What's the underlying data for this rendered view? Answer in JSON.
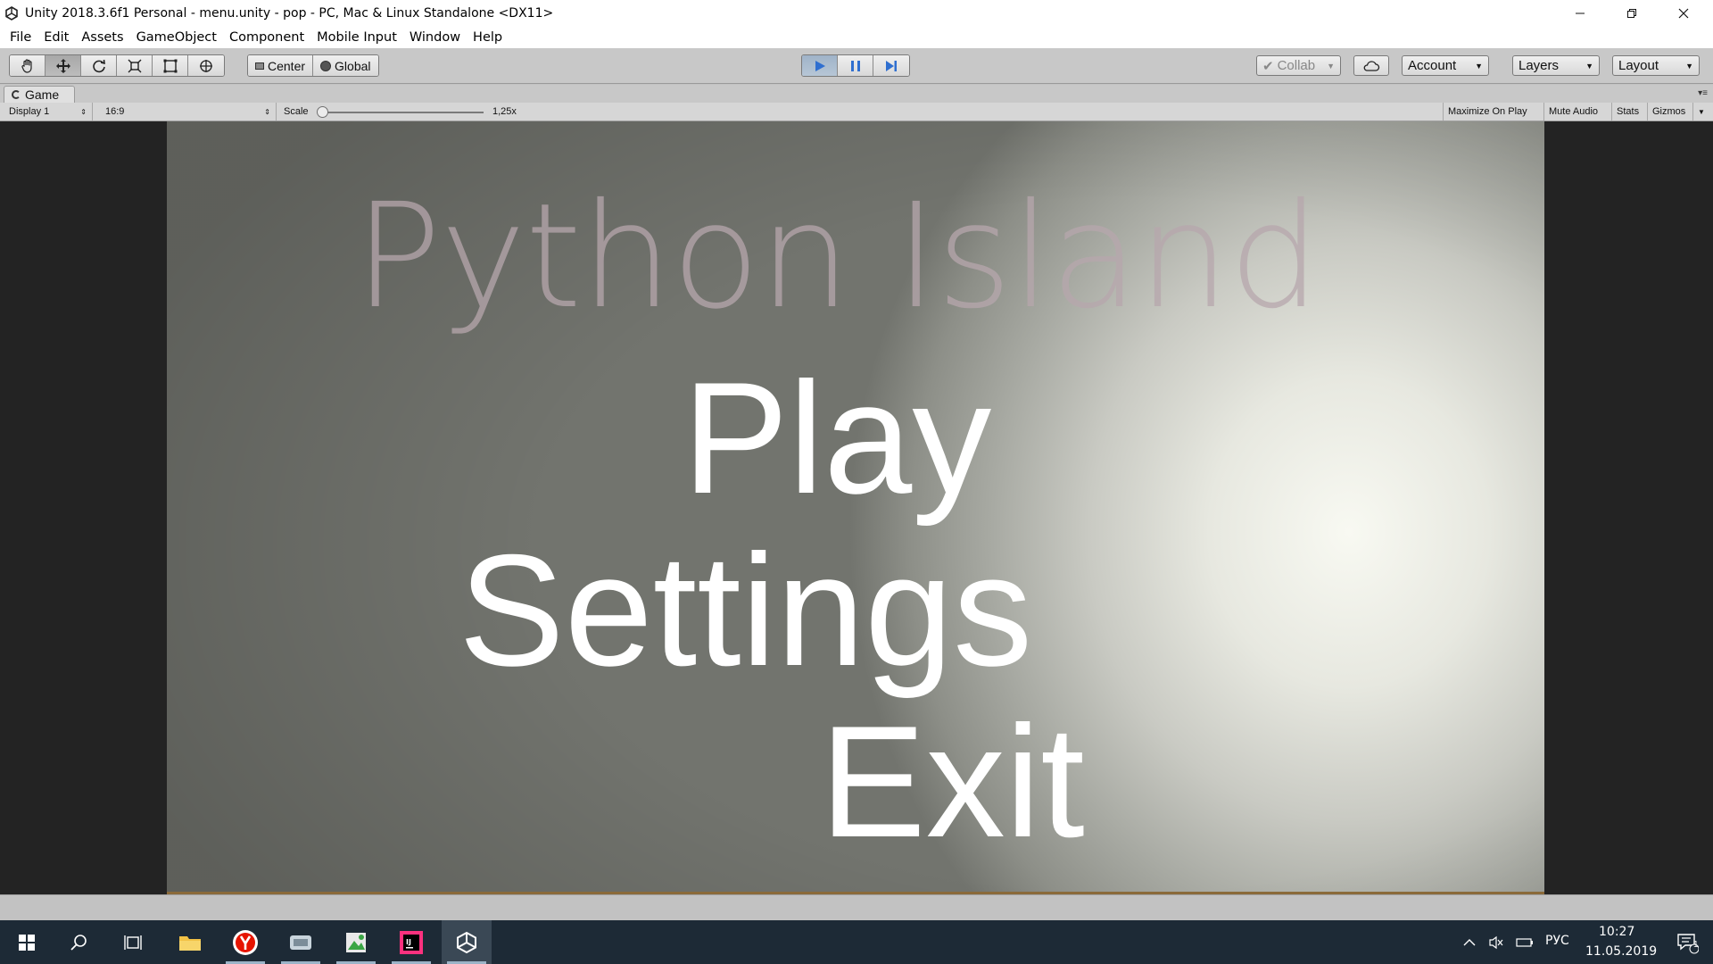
{
  "window": {
    "title": "Unity 2018.3.6f1 Personal - menu.unity - pop - PC, Mac & Linux Standalone <DX11>"
  },
  "menubar": {
    "items": [
      "File",
      "Edit",
      "Assets",
      "GameObject",
      "Component",
      "Mobile Input",
      "Window",
      "Help"
    ]
  },
  "toolbar": {
    "tools": [
      "hand-tool",
      "move-tool",
      "rotate-tool",
      "scale-tool",
      "rect-tool",
      "transform-tool"
    ],
    "active_tool": "move-tool",
    "pivot": "Center",
    "space": "Global",
    "playing": true,
    "collab": "Collab",
    "account": "Account",
    "layers": "Layers",
    "layout": "Layout"
  },
  "game_view": {
    "tab_label": "Game",
    "display": "Display 1",
    "aspect": "16:9",
    "scale_label": "Scale",
    "scale_value": "1,25x",
    "buttons": [
      "Maximize On Play",
      "Mute Audio",
      "Stats",
      "Gizmos"
    ]
  },
  "scene": {
    "title": "Python Island",
    "menu_items": [
      "Play",
      "Settings",
      "Exit"
    ]
  },
  "taskbar": {
    "language": "РУС",
    "time": "10:27",
    "date": "11.05.2019",
    "notifications": "1"
  },
  "colors": {
    "play_accent": "#2f6fd0",
    "taskbar": "#1d2a36"
  }
}
